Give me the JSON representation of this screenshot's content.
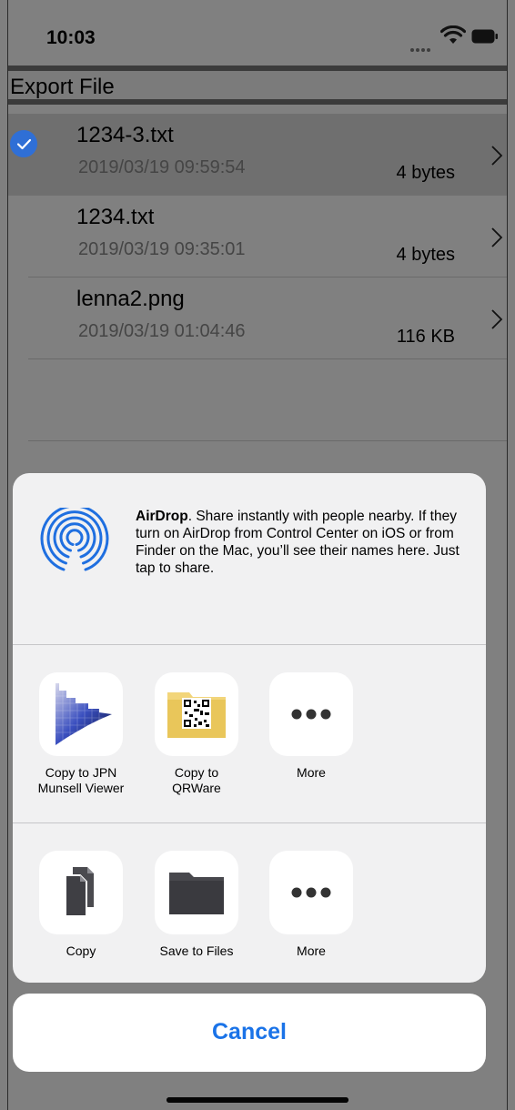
{
  "status": {
    "time": "10:03"
  },
  "header": {
    "title": "Export File"
  },
  "files": [
    {
      "name": "1234-3.txt",
      "date": "2019/03/19  09:59:54",
      "size": "4 bytes",
      "selected": true
    },
    {
      "name": "1234.txt",
      "date": "2019/03/19  09:35:01",
      "size": "4 bytes",
      "selected": false
    },
    {
      "name": "lenna2.png",
      "date": "2019/03/19  01:04:46",
      "size": "116 KB",
      "selected": false
    }
  ],
  "share": {
    "airdrop_title": "AirDrop",
    "airdrop_text": ". Share instantly with people nearby. If they turn on AirDrop from Control Center on iOS or from Finder on the Mac, you’ll see their names here. Just tap to share.",
    "apps": [
      {
        "label": "Copy to JPN\nMunsell Viewer",
        "icon": "munsell-viewer-icon"
      },
      {
        "label": "Copy to\nQRWare",
        "icon": "qrware-icon"
      },
      {
        "label": "More",
        "icon": "more-icon"
      }
    ],
    "actions": [
      {
        "label": "Copy",
        "icon": "copy-icon"
      },
      {
        "label": "Save to Files",
        "icon": "folder-icon"
      },
      {
        "label": "More",
        "icon": "more-icon"
      }
    ],
    "cancel": "Cancel"
  },
  "colors": {
    "accent": "#1a73e8",
    "airdrop": "#1f6fe0"
  }
}
